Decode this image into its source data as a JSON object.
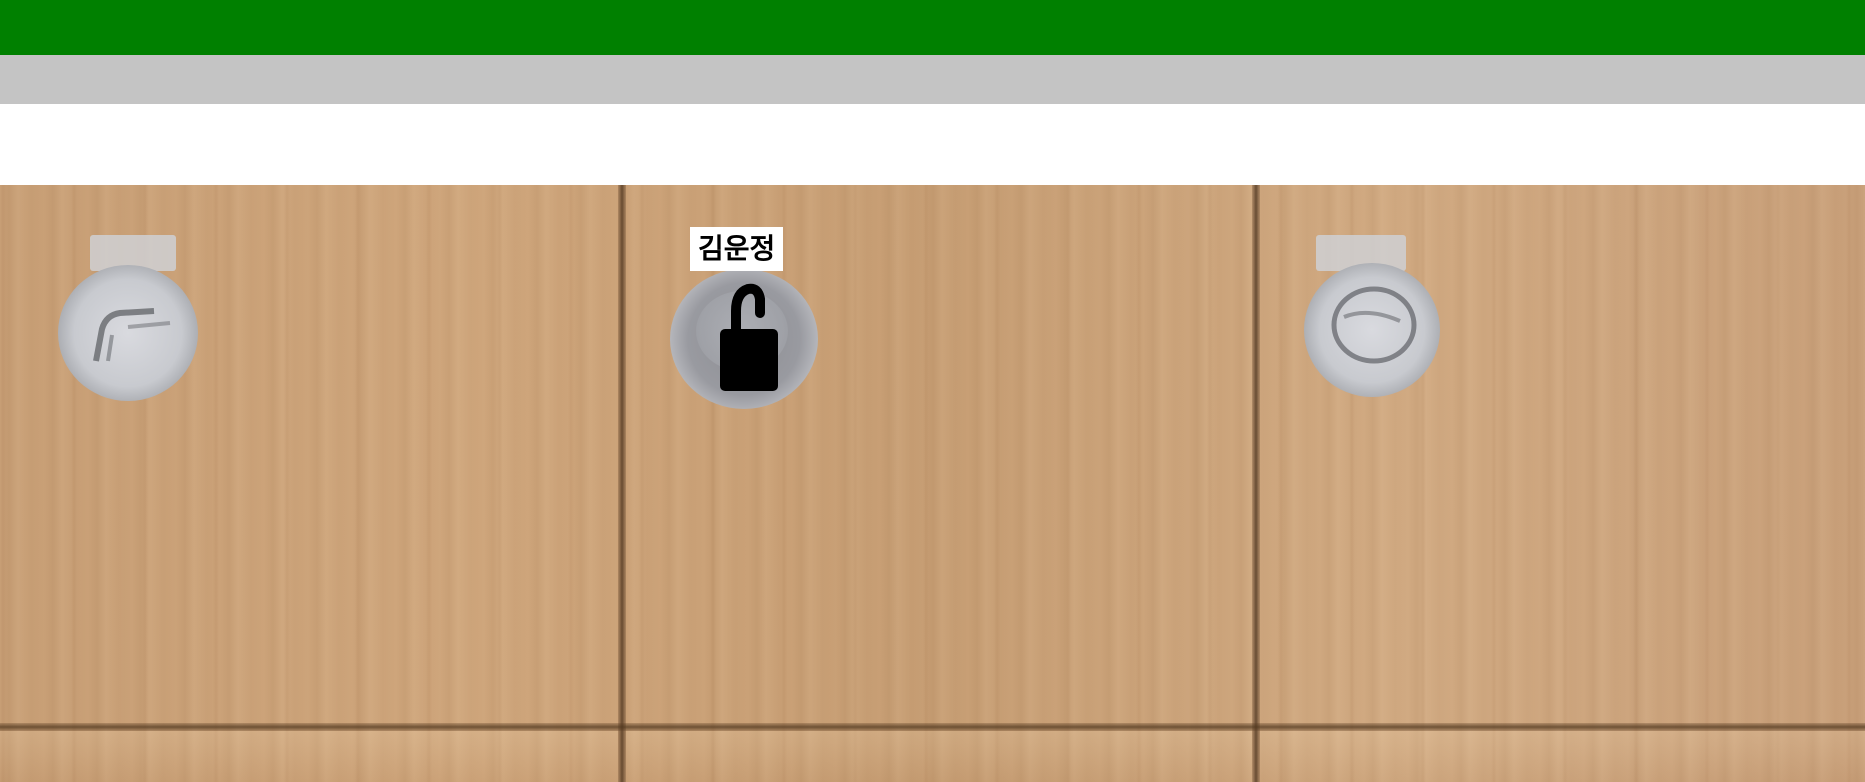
{
  "header": {
    "bar_color": "#008000",
    "subbar_color": "#c4c4c4"
  },
  "lockers": [
    {
      "status": "available",
      "icon": "empty-lock-slot-icon"
    },
    {
      "status": "occupied",
      "owner_name": "김운정",
      "icon": "padlock-icon"
    },
    {
      "status": "available",
      "icon": "empty-lock-slot-icon"
    }
  ]
}
